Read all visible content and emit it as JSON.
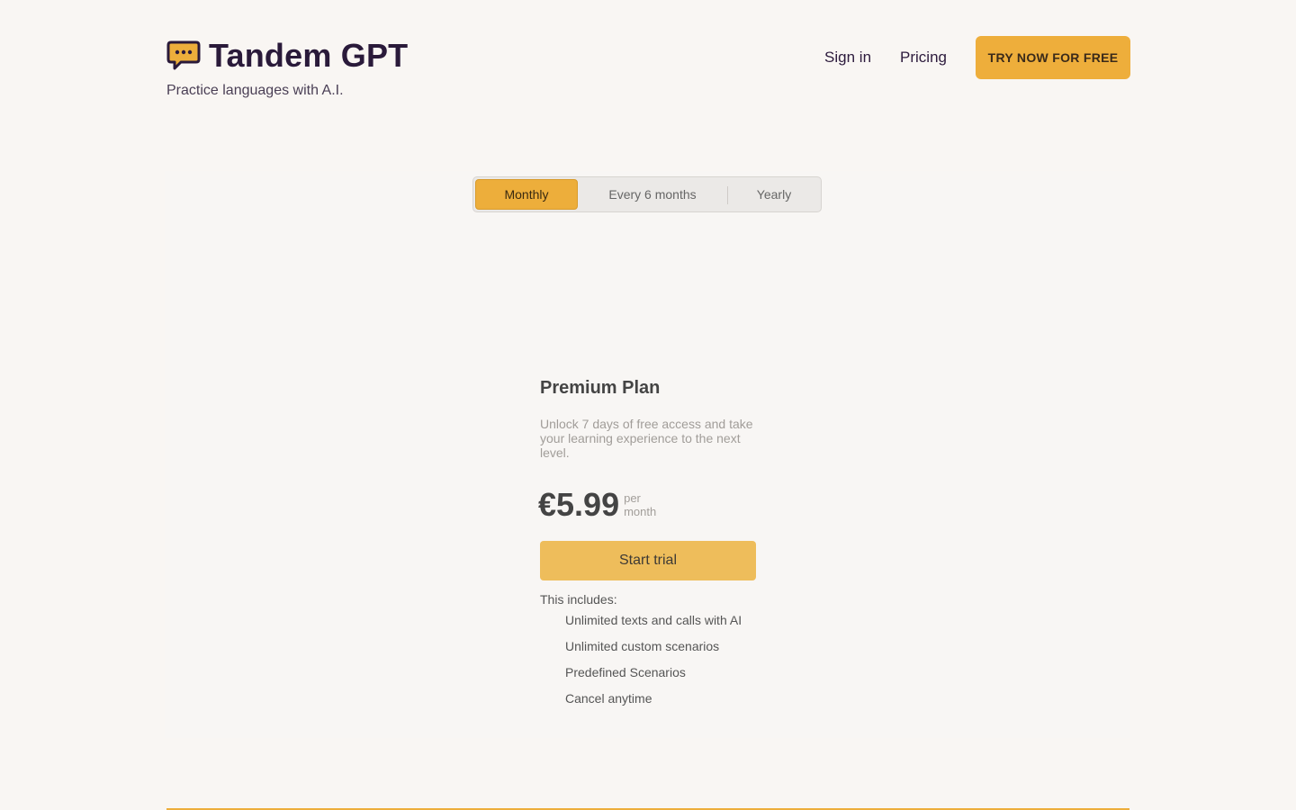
{
  "brand": {
    "name": "Tandem GPT",
    "tagline": "Practice languages with A.I.",
    "icon": "chat-bubble-icon"
  },
  "nav": {
    "sign_in": "Sign in",
    "pricing": "Pricing",
    "cta": "TRY NOW FOR FREE"
  },
  "billing_toggle": {
    "options": [
      "Monthly",
      "Every 6 months",
      "Yearly"
    ],
    "selected": "Monthly"
  },
  "plan": {
    "title": "Premium Plan",
    "description": "Unlock 7 days of free access and take your learning experience to the next level.",
    "price": "€5.99",
    "price_unit_1": "per",
    "price_unit_2": "month",
    "button": "Start trial",
    "includes_label": "This includes:",
    "features": [
      "Unlimited texts and calls with AI",
      "Unlimited custom scenarios",
      "Predefined Scenarios",
      "Cancel anytime"
    ]
  },
  "colors": {
    "accent": "#edae3b",
    "background": "#f9f6f3",
    "brand_text": "#2a1a3a"
  }
}
